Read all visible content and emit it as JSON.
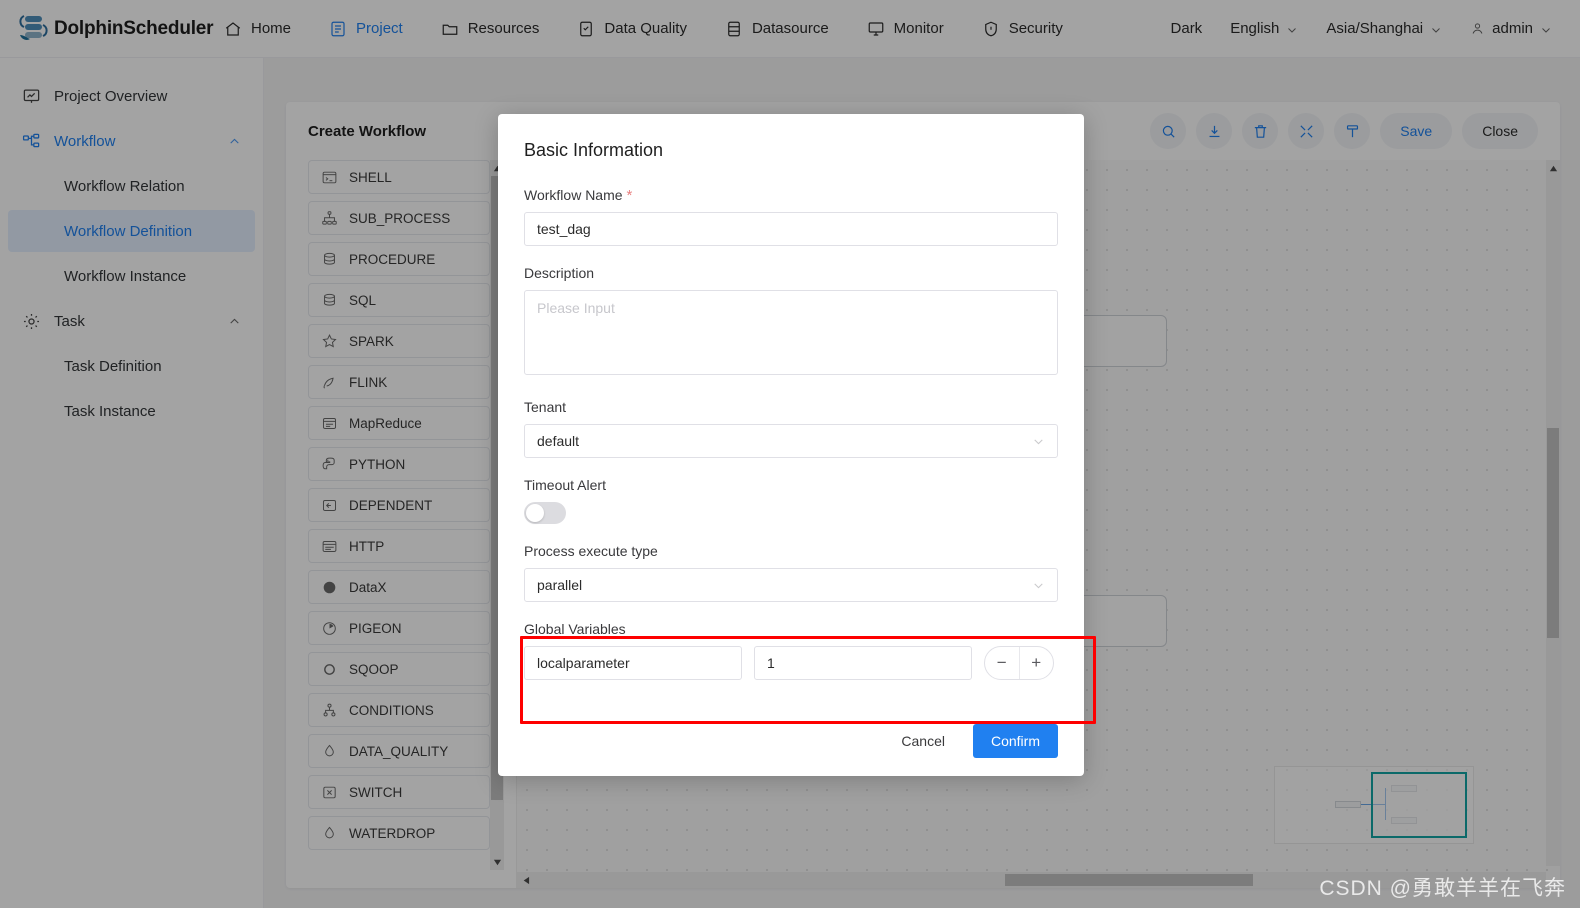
{
  "header": {
    "brand": "DolphinScheduler",
    "nav": [
      {
        "label": "Home",
        "icon": "home-icon",
        "active": false
      },
      {
        "label": "Project",
        "icon": "project-icon",
        "active": true
      },
      {
        "label": "Resources",
        "icon": "folder-icon",
        "active": false
      },
      {
        "label": "Data Quality",
        "icon": "data-quality-icon",
        "active": false
      },
      {
        "label": "Datasource",
        "icon": "datasource-icon",
        "active": false
      },
      {
        "label": "Monitor",
        "icon": "monitor-icon",
        "active": false
      },
      {
        "label": "Security",
        "icon": "shield-icon",
        "active": false
      }
    ],
    "theme_label": "Dark",
    "language": "English",
    "timezone": "Asia/Shanghai",
    "user": "admin"
  },
  "sidebar": {
    "items": [
      {
        "label": "Project Overview",
        "type": "item",
        "icon": "overview-icon"
      },
      {
        "label": "Workflow",
        "type": "group",
        "icon": "workflow-icon",
        "expanded": true
      },
      {
        "label": "Workflow Relation",
        "type": "child",
        "selected": false
      },
      {
        "label": "Workflow Definition",
        "type": "child",
        "selected": true
      },
      {
        "label": "Workflow Instance",
        "type": "child",
        "selected": false
      },
      {
        "label": "Task",
        "type": "group",
        "icon": "gear-icon",
        "expanded": true
      },
      {
        "label": "Task Definition",
        "type": "child",
        "selected": false
      },
      {
        "label": "Task Instance",
        "type": "child",
        "selected": false
      }
    ]
  },
  "card": {
    "title": "Create Workflow",
    "toolbar": {
      "icons": [
        "search-icon",
        "download-icon",
        "trash-icon",
        "fullscreen-icon",
        "format-icon"
      ],
      "save_label": "Save",
      "close_label": "Close"
    }
  },
  "palette": {
    "items": [
      {
        "label": "SHELL",
        "icon": "shell-icon"
      },
      {
        "label": "SUB_PROCESS",
        "icon": "sub-process-icon"
      },
      {
        "label": "PROCEDURE",
        "icon": "procedure-icon"
      },
      {
        "label": "SQL",
        "icon": "sql-icon"
      },
      {
        "label": "SPARK",
        "icon": "spark-icon"
      },
      {
        "label": "FLINK",
        "icon": "flink-icon"
      },
      {
        "label": "MapReduce",
        "icon": "mapreduce-icon"
      },
      {
        "label": "PYTHON",
        "icon": "python-icon"
      },
      {
        "label": "DEPENDENT",
        "icon": "dependent-icon"
      },
      {
        "label": "HTTP",
        "icon": "http-icon"
      },
      {
        "label": "DataX",
        "icon": "datax-icon"
      },
      {
        "label": "PIGEON",
        "icon": "pigeon-icon"
      },
      {
        "label": "SQOOP",
        "icon": "sqoop-icon"
      },
      {
        "label": "CONDITIONS",
        "icon": "conditions-icon"
      },
      {
        "label": "DATA_QUALITY",
        "icon": "data-quality-icon"
      },
      {
        "label": "SWITCH",
        "icon": "switch-icon"
      },
      {
        "label": "WATERDROP",
        "icon": "waterdrop-icon"
      }
    ]
  },
  "modal": {
    "title": "Basic Information",
    "workflow_name": {
      "label": "Workflow Name",
      "required": true,
      "value": "test_dag"
    },
    "description": {
      "label": "Description",
      "value": "",
      "placeholder": "Please Input"
    },
    "tenant": {
      "label": "Tenant",
      "value": "default"
    },
    "timeout_alert": {
      "label": "Timeout Alert",
      "enabled": false
    },
    "process_execute_type": {
      "label": "Process execute type",
      "value": "parallel"
    },
    "global_variables": {
      "label": "Global Variables",
      "rows": [
        {
          "key": "localparameter",
          "value": "1"
        }
      ],
      "minus_label": "−",
      "plus_label": "+",
      "highlight_color": "#fe0000"
    },
    "cancel_label": "Cancel",
    "confirm_label": "Confirm"
  },
  "watermark": "CSDN @勇敢羊羊在飞奔",
  "colors": {
    "accent": "#2080f0",
    "selected_bg": "#e5efff",
    "highlight": "#fe0000",
    "minimap_border": "#12a5a5"
  }
}
